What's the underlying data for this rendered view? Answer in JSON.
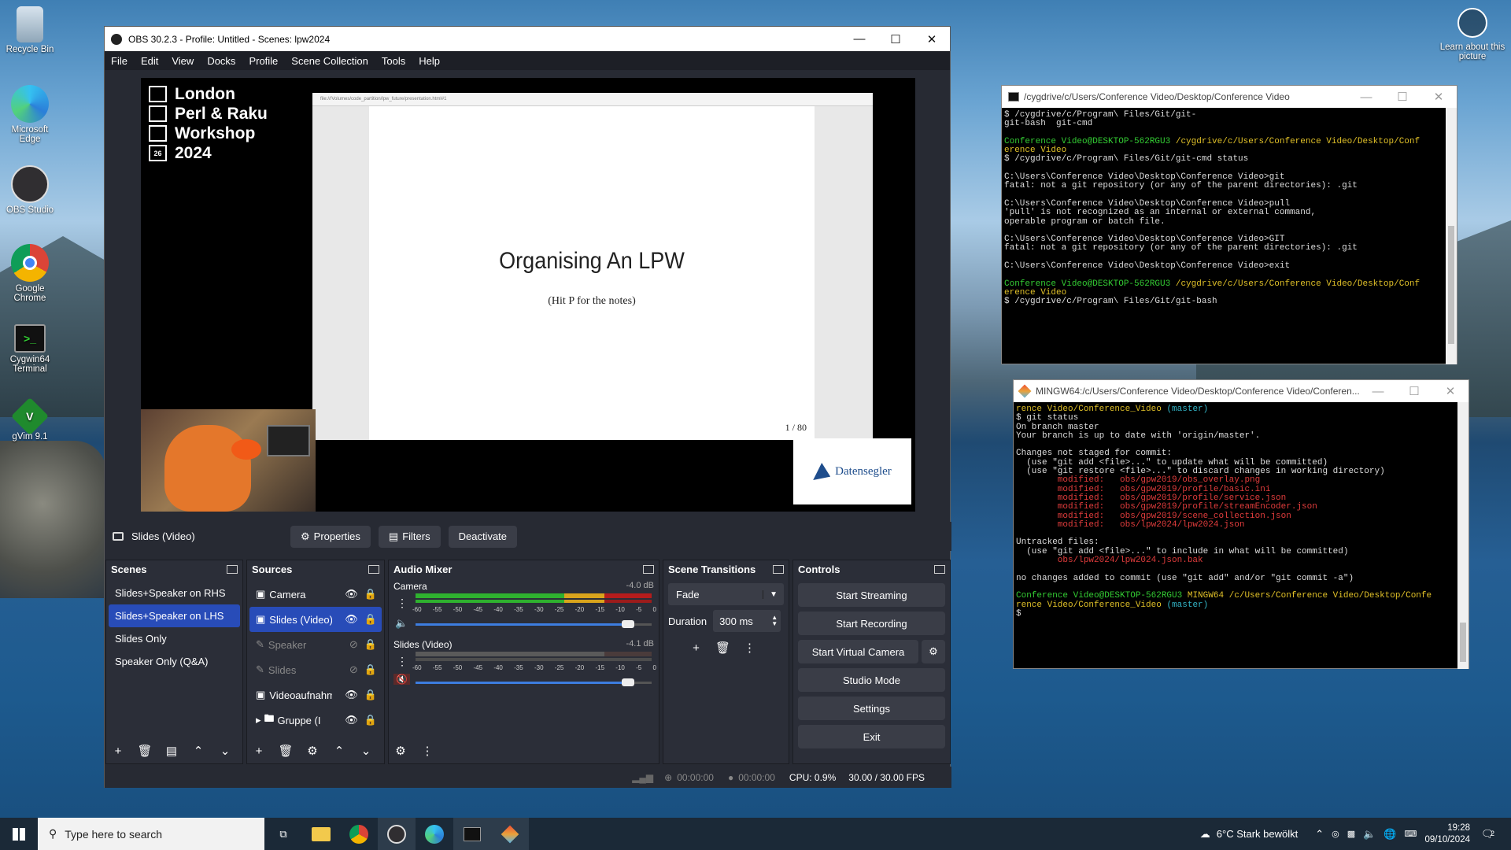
{
  "desktop": {
    "icons": [
      {
        "label": "Recycle Bin",
        "icon": "recycle-bin-icon"
      },
      {
        "label": "Microsoft Edge",
        "icon": "edge-icon"
      },
      {
        "label": "OBS Studio",
        "icon": "obs-icon"
      },
      {
        "label": "Google Chrome",
        "icon": "chrome-icon"
      },
      {
        "label": "Cygwin64 Terminal",
        "icon": "cygwin-icon"
      },
      {
        "label": "gVim 9.1",
        "icon": "gvim-icon"
      }
    ],
    "learn_label": "Learn about this picture"
  },
  "obs": {
    "title": "OBS 30.2.3 - Profile: Untitled - Scenes: lpw2024",
    "menu": [
      "File",
      "Edit",
      "View",
      "Docks",
      "Profile",
      "Scene Collection",
      "Tools",
      "Help"
    ],
    "preview": {
      "logo_lines": [
        "London",
        "Perl & Raku",
        "Workshop",
        "2024"
      ],
      "logo_date_box": "26",
      "slide_url": "file:///Volumes/code_partition/lpw_future/presentation.html#1",
      "slide_title": "Organising An LPW",
      "slide_subtitle": "(Hit P for the notes)",
      "slide_page": "1 / 80",
      "sponsor": "Datensegler"
    },
    "source_toolbar": {
      "selected_source": "Slides (Video)",
      "properties": "Properties",
      "filters": "Filters",
      "deactivate": "Deactivate"
    },
    "scenes": {
      "title": "Scenes",
      "items": [
        "Slides+Speaker on RHS",
        "Slides+Speaker on LHS",
        "Slides Only",
        "Speaker Only (Q&A)"
      ],
      "selected_index": 1
    },
    "sources": {
      "title": "Sources",
      "items": [
        "Camera",
        "Slides (Video)",
        "Speaker",
        "Slides",
        "Videoaufnahme",
        "Gruppe (I"
      ],
      "selected_index": 1
    },
    "audio_mixer": {
      "title": "Audio Mixer",
      "channels": [
        {
          "name": "Camera",
          "db": "-4.0 dB",
          "muted": false,
          "volume_level": 0.9
        },
        {
          "name": "Slides (Video)",
          "db": "-4.1 dB",
          "muted": true,
          "volume_level": 0.9
        }
      ],
      "scale": [
        "-60",
        "-55",
        "-50",
        "-45",
        "-40",
        "-35",
        "-30",
        "-25",
        "-20",
        "-15",
        "-10",
        "-5",
        "0"
      ]
    },
    "transitions": {
      "title": "Scene Transitions",
      "type": "Fade",
      "duration_label": "Duration",
      "duration": "300 ms"
    },
    "controls": {
      "title": "Controls",
      "buttons": [
        "Start Streaming",
        "Start Recording",
        "Start Virtual Camera",
        "Studio Mode",
        "Settings",
        "Exit"
      ]
    },
    "status": {
      "stream_time": "00:00:00",
      "rec_time": "00:00:00",
      "cpu": "CPU: 0.9%",
      "fps": "30.00 / 30.00 FPS"
    }
  },
  "cygwin": {
    "title": "/cygdrive/c/Users/Conference Video/Desktop/Conference Video",
    "lines": [
      {
        "t": "$ /cygdrive/c/Program\\ Files/Git/git-",
        "c": ""
      },
      {
        "t": "git-bash  git-cmd",
        "c": ""
      },
      {
        "t": "",
        "c": ""
      },
      {
        "t": "Conference Video@DESKTOP-562RGU3 ",
        "c": "g",
        "t2": "/cygdrive/c/Users/Conference Video/Desktop/Conf",
        "c2": "y"
      },
      {
        "t": "erence Video",
        "c": "y"
      },
      {
        "t": "$ /cygdrive/c/Program\\ Files/Git/git-cmd status",
        "c": ""
      },
      {
        "t": "",
        "c": ""
      },
      {
        "t": "C:\\Users\\Conference Video\\Desktop\\Conference Video>git",
        "c": ""
      },
      {
        "t": "fatal: not a git repository (or any of the parent directories): .git",
        "c": ""
      },
      {
        "t": "",
        "c": ""
      },
      {
        "t": "C:\\Users\\Conference Video\\Desktop\\Conference Video>pull",
        "c": ""
      },
      {
        "t": "'pull' is not recognized as an internal or external command,",
        "c": ""
      },
      {
        "t": "operable program or batch file.",
        "c": ""
      },
      {
        "t": "",
        "c": ""
      },
      {
        "t": "C:\\Users\\Conference Video\\Desktop\\Conference Video>GIT",
        "c": ""
      },
      {
        "t": "fatal: not a git repository (or any of the parent directories): .git",
        "c": ""
      },
      {
        "t": "",
        "c": ""
      },
      {
        "t": "C:\\Users\\Conference Video\\Desktop\\Conference Video>exit",
        "c": ""
      },
      {
        "t": "",
        "c": ""
      },
      {
        "t": "Conference Video@DESKTOP-562RGU3 ",
        "c": "g",
        "t2": "/cygdrive/c/Users/Conference Video/Desktop/Conf",
        "c2": "y"
      },
      {
        "t": "erence Video",
        "c": "y"
      },
      {
        "t": "$ /cygdrive/c/Program\\ Files/Git/git-bash",
        "c": ""
      }
    ]
  },
  "mingw": {
    "title": "MINGW64:/c/Users/Conference Video/Desktop/Conference Video/Conferen...",
    "lines": [
      {
        "t": "rence Video/Conference_Video ",
        "c": "y",
        "t2": "(master)",
        "c2": "c"
      },
      {
        "t": "$ git status",
        "c": ""
      },
      {
        "t": "On branch master",
        "c": ""
      },
      {
        "t": "Your branch is up to date with 'origin/master'.",
        "c": ""
      },
      {
        "t": "",
        "c": ""
      },
      {
        "t": "Changes not staged for commit:",
        "c": ""
      },
      {
        "t": "  (use \"git add <file>...\" to update what will be committed)",
        "c": ""
      },
      {
        "t": "  (use \"git restore <file>...\" to discard changes in working directory)",
        "c": ""
      },
      {
        "t": "        modified:   obs/gpw2019/obs_overlay.png",
        "c": "r"
      },
      {
        "t": "        modified:   obs/gpw2019/profile/basic.ini",
        "c": "r"
      },
      {
        "t": "        modified:   obs/gpw2019/profile/service.json",
        "c": "r"
      },
      {
        "t": "        modified:   obs/gpw2019/profile/streamEncoder.json",
        "c": "r"
      },
      {
        "t": "        modified:   obs/gpw2019/scene_collection.json",
        "c": "r"
      },
      {
        "t": "        modified:   obs/lpw2024/lpw2024.json",
        "c": "r"
      },
      {
        "t": "",
        "c": ""
      },
      {
        "t": "Untracked files:",
        "c": ""
      },
      {
        "t": "  (use \"git add <file>...\" to include in what will be committed)",
        "c": ""
      },
      {
        "t": "        obs/lpw2024/lpw2024.json.bak",
        "c": "r"
      },
      {
        "t": "",
        "c": ""
      },
      {
        "t": "no changes added to commit (use \"git add\" and/or \"git commit -a\")",
        "c": ""
      },
      {
        "t": "",
        "c": ""
      },
      {
        "t": "Conference Video@DESKTOP-562RGU3 ",
        "c": "g",
        "t2": "MINGW64 /c/Users/Conference Video/Desktop/Confe",
        "c2": "y"
      },
      {
        "t": "rence Video/Conference_Video ",
        "c": "y",
        "t2": "(master)",
        "c2": "c"
      },
      {
        "t": "$ ",
        "c": ""
      }
    ]
  },
  "taskbar": {
    "search_placeholder": "Type here to search",
    "weather": "6°C  Stark bewölkt",
    "time": "19:28",
    "date": "09/10/2024",
    "notification_count": "2"
  }
}
